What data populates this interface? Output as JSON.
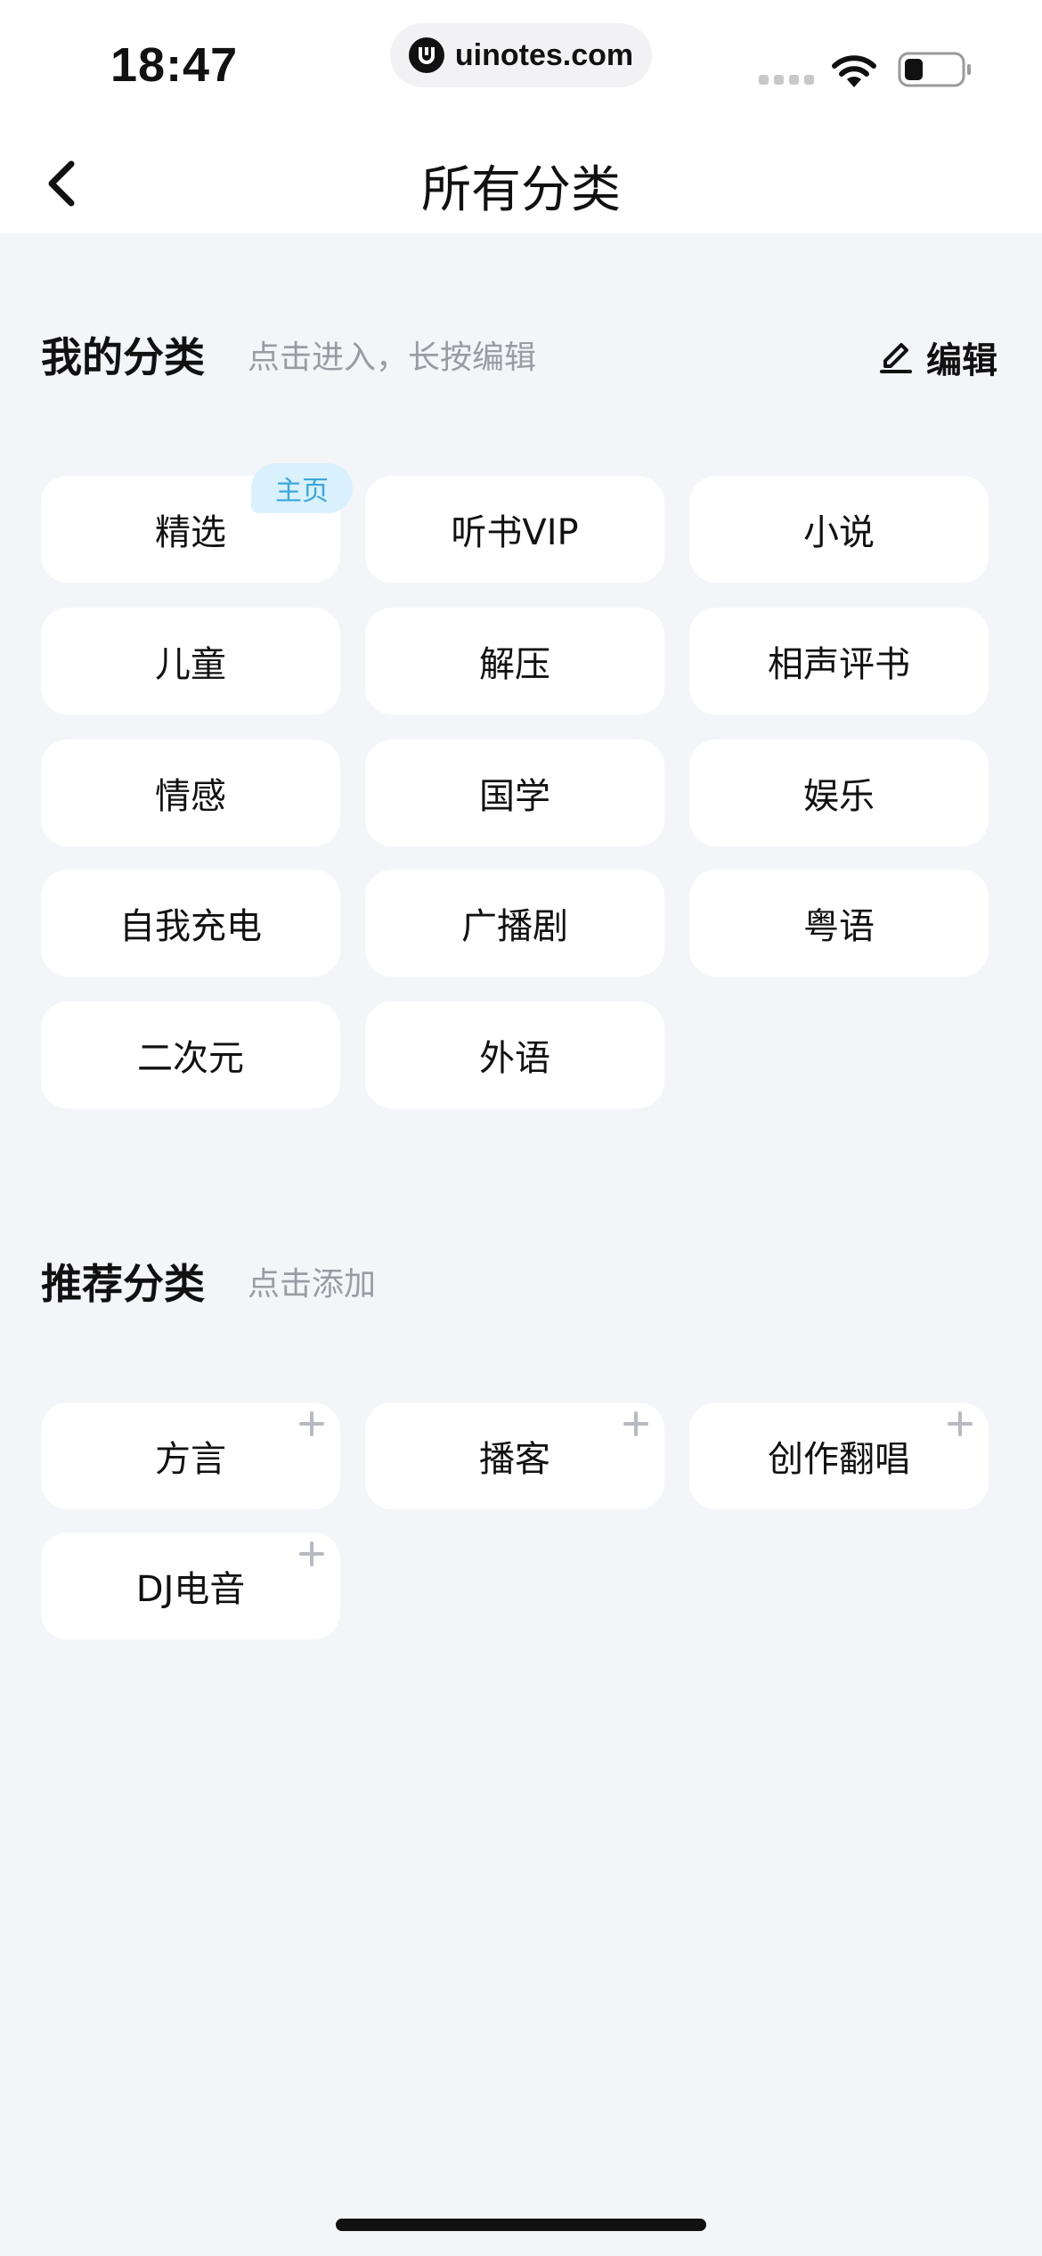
{
  "status": {
    "time": "18:47",
    "url": "uinotes.com"
  },
  "nav": {
    "title": "所有分类"
  },
  "my_categories": {
    "title": "我的分类",
    "hint": "点击进入，长按编辑",
    "edit_label": "编辑",
    "home_badge": "主页",
    "items": [
      {
        "label": "精选"
      },
      {
        "label": "听书VIP"
      },
      {
        "label": "小说"
      },
      {
        "label": "儿童"
      },
      {
        "label": "解压"
      },
      {
        "label": "相声评书"
      },
      {
        "label": "情感"
      },
      {
        "label": "国学"
      },
      {
        "label": "娱乐"
      },
      {
        "label": "自我充电"
      },
      {
        "label": "广播剧"
      },
      {
        "label": "粤语"
      },
      {
        "label": "二次元"
      },
      {
        "label": "外语"
      }
    ]
  },
  "recommended": {
    "title": "推荐分类",
    "hint": "点击添加",
    "items": [
      {
        "label": "方言"
      },
      {
        "label": "播客"
      },
      {
        "label": "创作翻唱"
      },
      {
        "label": "DJ电音"
      }
    ]
  },
  "colors": {
    "background": "#f4f5f9",
    "tile": "#ffffff",
    "badge_bg": "#d9f1fc",
    "badge_text": "#3aa6dd",
    "hint_text": "#9a9ca4"
  }
}
